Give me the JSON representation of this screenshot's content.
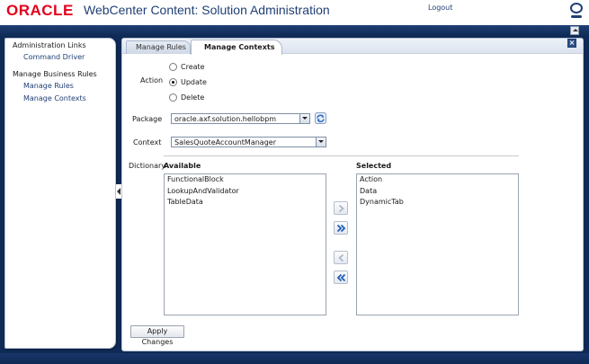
{
  "header": {
    "logo_text": "ORACLE",
    "title": "WebCenter Content: Solution Administration",
    "logout_label": "Logout"
  },
  "sidebar": {
    "groups": [
      {
        "label": "Administration Links",
        "items": [
          {
            "label": "Command Driver"
          }
        ]
      },
      {
        "label": "Manage Business Rules",
        "items": [
          {
            "label": "Manage Rules"
          },
          {
            "label": "Manage Contexts"
          }
        ]
      }
    ]
  },
  "tabs": [
    {
      "label": "Manage Rules",
      "active": false
    },
    {
      "label": "Manage Contexts",
      "active": true
    }
  ],
  "form": {
    "action_label": "Action",
    "action_options": [
      {
        "label": "Create",
        "selected": false
      },
      {
        "label": "Update",
        "selected": true
      },
      {
        "label": "Delete",
        "selected": false
      }
    ],
    "package_label": "Package",
    "package_value": "oracle.axf.solution.hellobpm",
    "context_label": "Context",
    "context_value": "SalesQuoteAccountManager",
    "dictionary_label": "Dictionary",
    "available_label": "Available",
    "selected_label": "Selected",
    "available_items": [
      "FunctionalBlock",
      "LookupAndValidator",
      "TableData"
    ],
    "selected_items": [
      "Action",
      "Data",
      "DynamicTab"
    ],
    "apply_label": "Apply Changes"
  },
  "colors": {
    "brand_red": "#e2001a",
    "header_blue": "#1f3f74",
    "background_navy": "#0f2a55"
  },
  "icons": [
    "help-icon",
    "close-icon",
    "refresh-icon",
    "move-right-icon",
    "move-all-right-icon",
    "move-left-icon",
    "move-all-left-icon",
    "collapse-icon"
  ]
}
